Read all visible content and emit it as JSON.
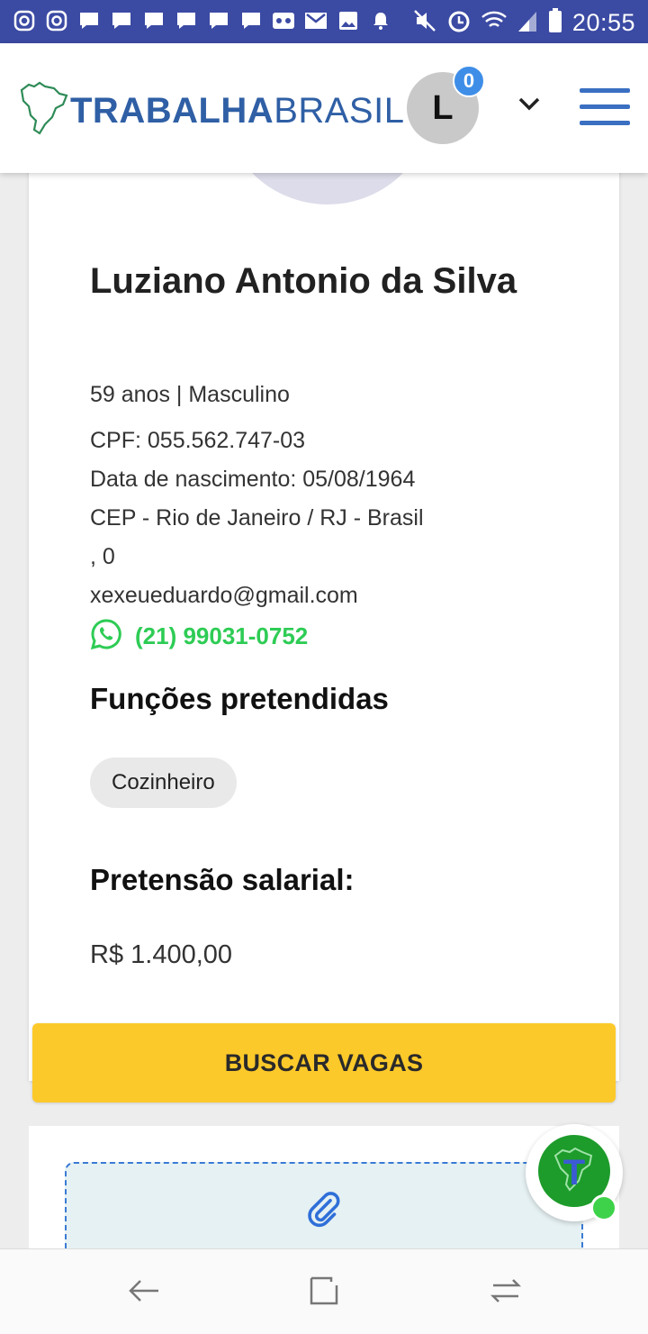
{
  "status_bar": {
    "time": "20:55",
    "left_icons": [
      "instagram-icon",
      "instagram-icon",
      "message-icon",
      "message-icon",
      "message-icon",
      "message-icon",
      "message-icon",
      "message-icon",
      "voicemail-icon",
      "gmail-icon",
      "image-icon",
      "bell-icon"
    ],
    "right_icons": [
      "mute-icon",
      "alarm-icon",
      "wifi-icon",
      "signal-icon",
      "battery-icon"
    ]
  },
  "header": {
    "logo_bold": "TRABALHA",
    "logo_light": "BRASIL",
    "avatar_letter": "L",
    "notification_count": "0"
  },
  "profile": {
    "name": "Luziano Antonio da Silva",
    "age_gender": "59 anos | Masculino",
    "cpf": "CPF: 055.562.747-03",
    "birth": "Data de nascimento: 05/08/1964",
    "location": "CEP - Rio de Janeiro / RJ - Brasil",
    "address": ", 0",
    "email": "xexeueduardo@gmail.com",
    "phone": "(21) 99031-0752"
  },
  "functions": {
    "title": "Funções pretendidas",
    "items": [
      "Cozinheiro"
    ]
  },
  "salary": {
    "title": "Pretensão salarial:",
    "value": "R$ 1.400,00"
  },
  "actions": {
    "search_jobs": "BUSCAR VAGAS"
  },
  "colors": {
    "status_bar": "#3b4aa3",
    "brand_blue": "#2f5fa5",
    "accent_yellow": "#fcc92a",
    "whatsapp_green": "#2ecc55"
  }
}
